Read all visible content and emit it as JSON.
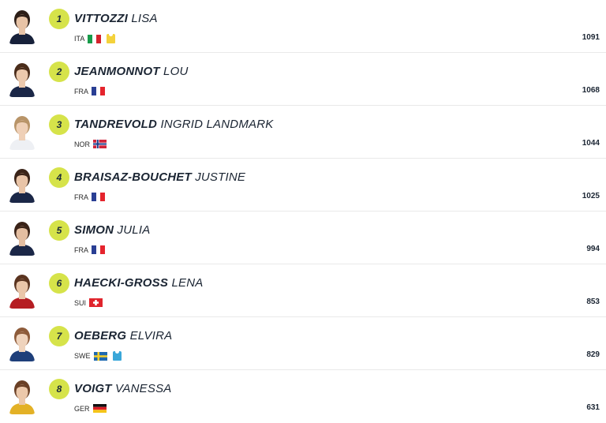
{
  "athletes": [
    {
      "rank": "1",
      "last": "VITTOZZI",
      "first": "LISA",
      "nation": "ITA",
      "flag": "ita",
      "bib": "yellow",
      "points": "1091",
      "skin": "#e7c3a6",
      "hair": "#2c1e17",
      "suit": "#17213a"
    },
    {
      "rank": "2",
      "last": "JEANMONNOT",
      "first": "LOU",
      "nation": "FRA",
      "flag": "fra",
      "bib": null,
      "points": "1068",
      "skin": "#ecc9ad",
      "hair": "#4a2c1a",
      "suit": "#1b2747"
    },
    {
      "rank": "3",
      "last": "TANDREVOLD",
      "first": "INGRID LANDMARK",
      "nation": "NOR",
      "flag": "nor",
      "bib": null,
      "points": "1044",
      "skin": "#efd0b7",
      "hair": "#b89468",
      "suit": "#eef0f4"
    },
    {
      "rank": "4",
      "last": "BRAISAZ-BOUCHET",
      "first": "JUSTINE",
      "nation": "FRA",
      "flag": "fra",
      "bib": null,
      "points": "1025",
      "skin": "#e9c4a7",
      "hair": "#3b2418",
      "suit": "#1b2747"
    },
    {
      "rank": "5",
      "last": "SIMON",
      "first": "JULIA",
      "nation": "FRA",
      "flag": "fra",
      "bib": null,
      "points": "994",
      "skin": "#e4bea1",
      "hair": "#3a2318",
      "suit": "#1b2747"
    },
    {
      "rank": "6",
      "last": "HAECKI-GROSS",
      "first": "LENA",
      "nation": "SUI",
      "flag": "sui",
      "bib": null,
      "points": "853",
      "skin": "#eac6a9",
      "hair": "#5a3420",
      "suit": "#b51d22"
    },
    {
      "rank": "7",
      "last": "OEBERG",
      "first": "ELVIRA",
      "nation": "SWE",
      "flag": "swe",
      "bib": "blue",
      "points": "829",
      "skin": "#efd3bc",
      "hair": "#8d5b3a",
      "suit": "#1e3f7a"
    },
    {
      "rank": "8",
      "last": "VOIGT",
      "first": "VANESSA",
      "nation": "GER",
      "flag": "ger",
      "bib": null,
      "points": "631",
      "skin": "#ecc8aa",
      "hair": "#6a4026",
      "suit": "#e3b126"
    }
  ]
}
